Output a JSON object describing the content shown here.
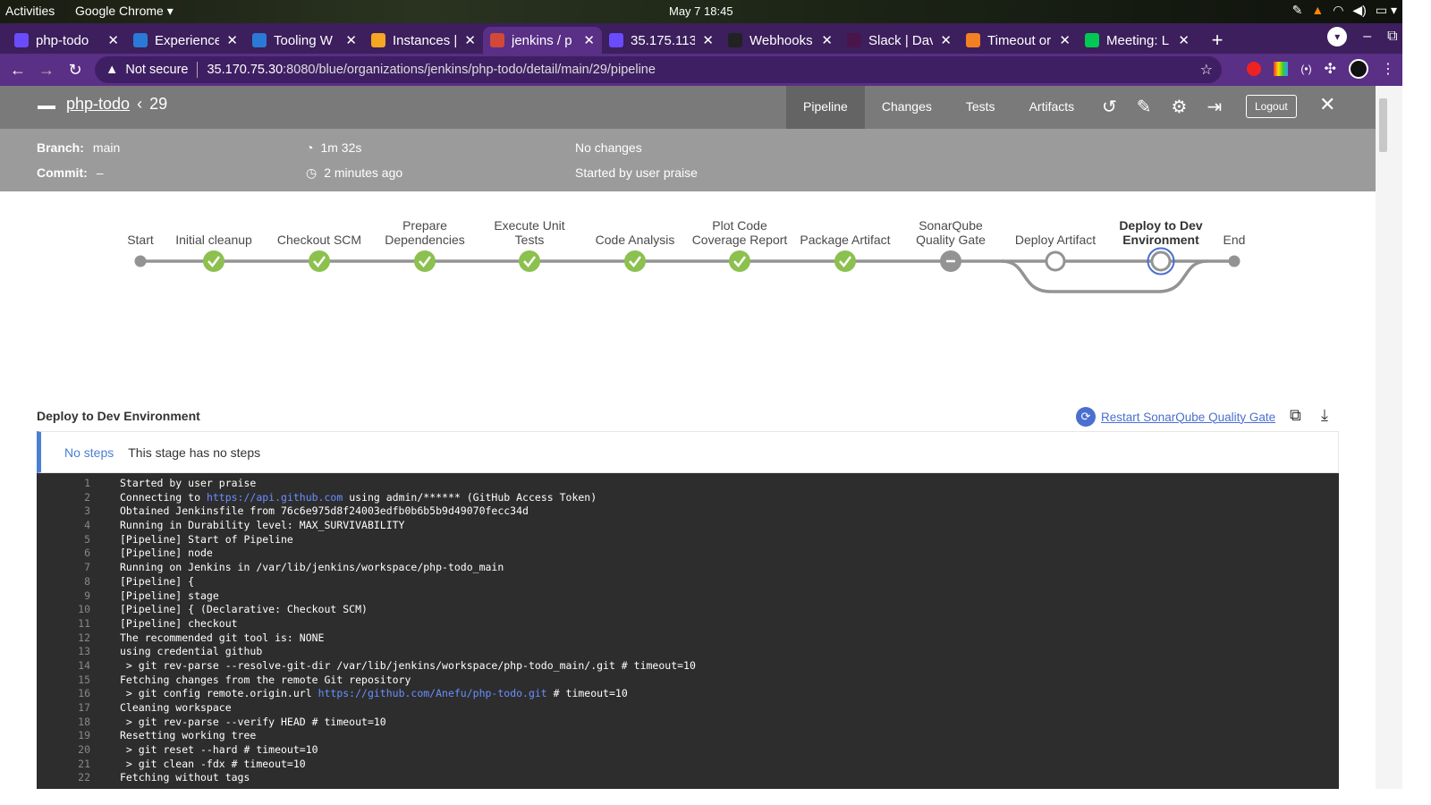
{
  "os": {
    "activities": "Activities",
    "app_name": "Google Chrome ▾",
    "clock": "May 7  18:45"
  },
  "tabs": [
    {
      "title": "php-todo",
      "color": "#6a4cff"
    },
    {
      "title": "Experience",
      "color": "#2b79d6"
    },
    {
      "title": "Tooling W",
      "color": "#2b79d6"
    },
    {
      "title": "Instances |",
      "color": "#f5a623"
    },
    {
      "title": "jenkins / p",
      "color": "#d24939"
    },
    {
      "title": "35.175.113",
      "color": "#6a4cff"
    },
    {
      "title": "Webhooks",
      "color": "#222222"
    },
    {
      "title": "Slack | Dav",
      "color": "#4a154b"
    },
    {
      "title": "Timeout or",
      "color": "#f48024"
    },
    {
      "title": "Meeting: L",
      "color": "#00c853"
    }
  ],
  "address": {
    "not_secure": "Not secure",
    "url_host": "35.170.75.30",
    "url_rest": ":8080/blue/organizations/jenkins/php-todo/detail/main/29/pipeline"
  },
  "header": {
    "project": "php-todo",
    "run": "29",
    "tabs": [
      "Pipeline",
      "Changes",
      "Tests",
      "Artifacts"
    ],
    "logout": "Logout"
  },
  "meta": {
    "branch_label": "Branch:",
    "branch": "main",
    "commit_label": "Commit:",
    "commit": "–",
    "duration": "1m 32s",
    "ago": "2 minutes ago",
    "changes": "No changes",
    "started_by": "Started by user praise"
  },
  "pipeline": {
    "stages": [
      {
        "label": "Start",
        "status": "start"
      },
      {
        "label": "Initial cleanup",
        "status": "success"
      },
      {
        "label": "Checkout SCM",
        "status": "success"
      },
      {
        "label": "Prepare Dependencies",
        "status": "success"
      },
      {
        "label": "Execute Unit Tests",
        "status": "success"
      },
      {
        "label": "Code Analysis",
        "status": "success"
      },
      {
        "label": "Plot Code Coverage Report",
        "status": "success"
      },
      {
        "label": "Package Artifact",
        "status": "success"
      },
      {
        "label": "SonarQube Quality Gate",
        "status": "skipped"
      },
      {
        "label": "Deploy Artifact",
        "status": "not_built"
      },
      {
        "label": "Deploy to Dev Environment",
        "status": "selected"
      },
      {
        "label": "End",
        "status": "end"
      }
    ],
    "success_color": "#8cc04f",
    "selected_color": "#4a6fd0"
  },
  "stage_detail": {
    "title": "Deploy to Dev Environment",
    "restart_label": "Restart SonarQube Quality Gate",
    "no_steps_label": "No steps",
    "no_steps_text": "This stage has no steps"
  },
  "log": [
    "Started by user praise",
    "Connecting to [[https://api.github.com]] using admin/****** (GitHub Access Token)",
    "Obtained Jenkinsfile from 76c6e975d8f24003edfb0b6b5b9d49070fecc34d",
    "Running in Durability level: MAX_SURVIVABILITY",
    "[Pipeline] Start of Pipeline",
    "[Pipeline] node",
    "Running on Jenkins in /var/lib/jenkins/workspace/php-todo_main",
    "[Pipeline] {",
    "[Pipeline] stage",
    "[Pipeline] { (Declarative: Checkout SCM)",
    "[Pipeline] checkout",
    "The recommended git tool is: NONE",
    "using credential github",
    " > git rev-parse --resolve-git-dir /var/lib/jenkins/workspace/php-todo_main/.git # timeout=10",
    "Fetching changes from the remote Git repository",
    " > git config remote.origin.url [[https://github.com/Anefu/php-todo.git]] # timeout=10",
    "Cleaning workspace",
    " > git rev-parse --verify HEAD # timeout=10",
    "Resetting working tree",
    " > git reset --hard # timeout=10",
    " > git clean -fdx # timeout=10",
    "Fetching without tags"
  ]
}
